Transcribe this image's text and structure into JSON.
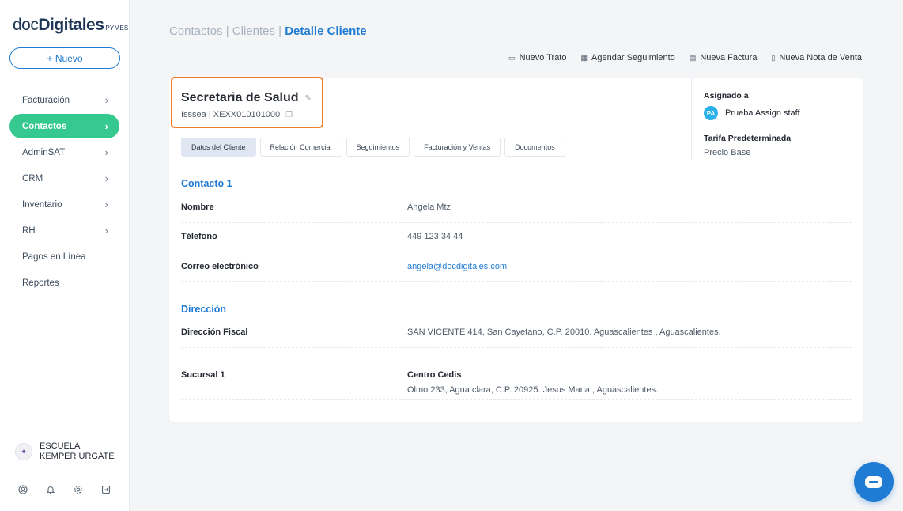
{
  "sidebar": {
    "logo": {
      "doc": "doc",
      "digitales": "Digitales",
      "pymes": "PYMES"
    },
    "new_button": {
      "icon": "plus-icon",
      "label": "+ Nuevo"
    },
    "items": [
      {
        "label": "Facturación",
        "has_chevron": true,
        "active": false
      },
      {
        "label": "Contactos",
        "has_chevron": true,
        "active": true
      },
      {
        "label": "AdminSAT",
        "has_chevron": true,
        "active": false
      },
      {
        "label": "CRM",
        "has_chevron": true,
        "active": false
      },
      {
        "label": "Inventario",
        "has_chevron": true,
        "active": false
      },
      {
        "label": "RH",
        "has_chevron": true,
        "active": false
      },
      {
        "label": "Pagos en Línea",
        "has_chevron": false,
        "active": false
      },
      {
        "label": "Reportes",
        "has_chevron": false,
        "active": false
      }
    ],
    "company": {
      "name": "ESCUELA KEMPER URGATE"
    },
    "footer_icons": [
      "user-circle-icon",
      "bell-icon",
      "gear-icon",
      "logout-icon"
    ],
    "active_color": "#35c88f"
  },
  "breadcrumb": {
    "part1": "Contactos",
    "sep1": " | ",
    "part2": "Clientes",
    "sep2": " | ",
    "current": "Detalle Cliente"
  },
  "actions": [
    {
      "icon": "deal-icon",
      "label": "Nuevo Trato"
    },
    {
      "icon": "calendar-icon",
      "label": "Agendar Seguimiento"
    },
    {
      "icon": "invoice-icon",
      "label": "Nueva Factura"
    },
    {
      "icon": "sales-note-icon",
      "label": "Nueva Nota de Venta"
    }
  ],
  "client": {
    "name": "Secretaria de Salud",
    "subtitle": "Isssea | XEXX010101000",
    "highlight_color": "#f07d26"
  },
  "tabs": [
    {
      "label": "Datos del Cliente",
      "active": true
    },
    {
      "label": "Relación Comercial",
      "active": false
    },
    {
      "label": "Seguimientos",
      "active": false
    },
    {
      "label": "Facturación y Ventas",
      "active": false
    },
    {
      "label": "Documentos",
      "active": false
    }
  ],
  "side_info": {
    "assigned_label": "Asignado a",
    "assignee_initials": "PA",
    "assignee_name": "Prueba Assign staff",
    "tariff_label": "Tarifa Predeterminada",
    "tariff_value": "Precio Base"
  },
  "contact": {
    "title": "Contacto 1",
    "rows": [
      {
        "key": "Nombre",
        "value": "Angela Mtz"
      },
      {
        "key": "Télefono",
        "value": "449 123 34 44"
      },
      {
        "key": "Correo electrónico",
        "value": "angela@docdigitales.com"
      }
    ]
  },
  "address": {
    "title": "Dirección",
    "fiscal_key": "Dirección Fiscal",
    "fiscal_value": "SAN VICENTE 414, San Cayetano, C.P. 20010. Aguascalientes , Aguascalientes.",
    "branch_key": "Sucursal 1",
    "branch_name": "Centro Cedis",
    "branch_address": "Olmo 233, Agua clara, C.P. 20925. Jesus Maria , Aguascalientes."
  },
  "accent_color": "#1f7bd3"
}
